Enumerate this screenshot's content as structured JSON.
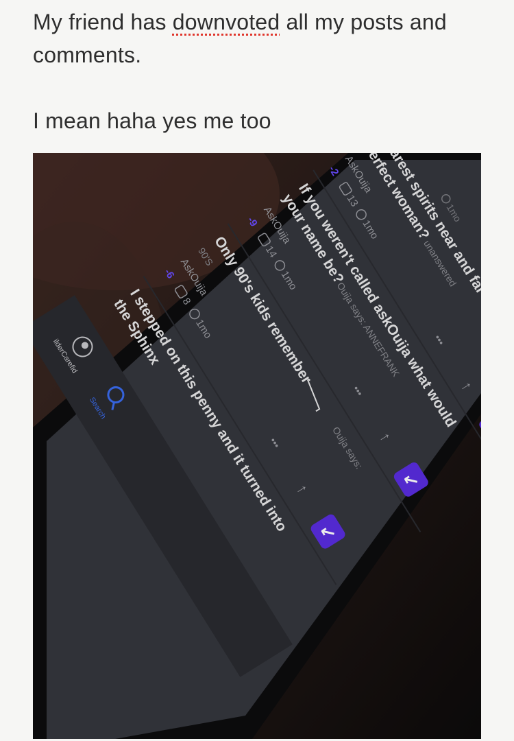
{
  "caption": {
    "line1_before": "My friend has ",
    "line1_misspelled": "downvoted",
    "line1_after": " all my posts and",
    "line2": "comments.",
    "line3": "I mean haha yes me too"
  },
  "colors": {
    "accent": "#5a2de0",
    "downvote": "#6a4cff",
    "feed_bg": "#3a3c42"
  },
  "phone_feed": {
    "top_time": "1mo",
    "posts": [
      {
        "title_line1": "Dearest spirits near and far",
        "title_line2": "perfect woman?",
        "status": "unanswered",
        "subreddit": "AskOuija",
        "votes": "-2",
        "comments": "13",
        "age": "1mo"
      },
      {
        "title_line1": "If you weren't called askOuija what would",
        "title_line2": "your name be?",
        "status": "Ouija says: ANNEFRANK",
        "subreddit": "AskOuija",
        "votes": "-9",
        "comments": "14",
        "age": "1mo"
      },
      {
        "title_line1": "Only 90's kids remember",
        "title_line2": "90'S",
        "status": "Ouija says:",
        "subreddit": "AskOuija",
        "votes": "-6",
        "comments": "8",
        "age": "1mo"
      },
      {
        "title_line1": "I stepped on this penny and it turned into",
        "title_line2": "the Sphinx",
        "status": "",
        "subreddit": "",
        "votes": "",
        "comments": "",
        "age": ""
      }
    ],
    "tabbar": {
      "username": "ilderCarefid",
      "search_label": "Search"
    },
    "more_glyph": "•••",
    "up_arrow": "↑",
    "down_arrow": "↙"
  }
}
